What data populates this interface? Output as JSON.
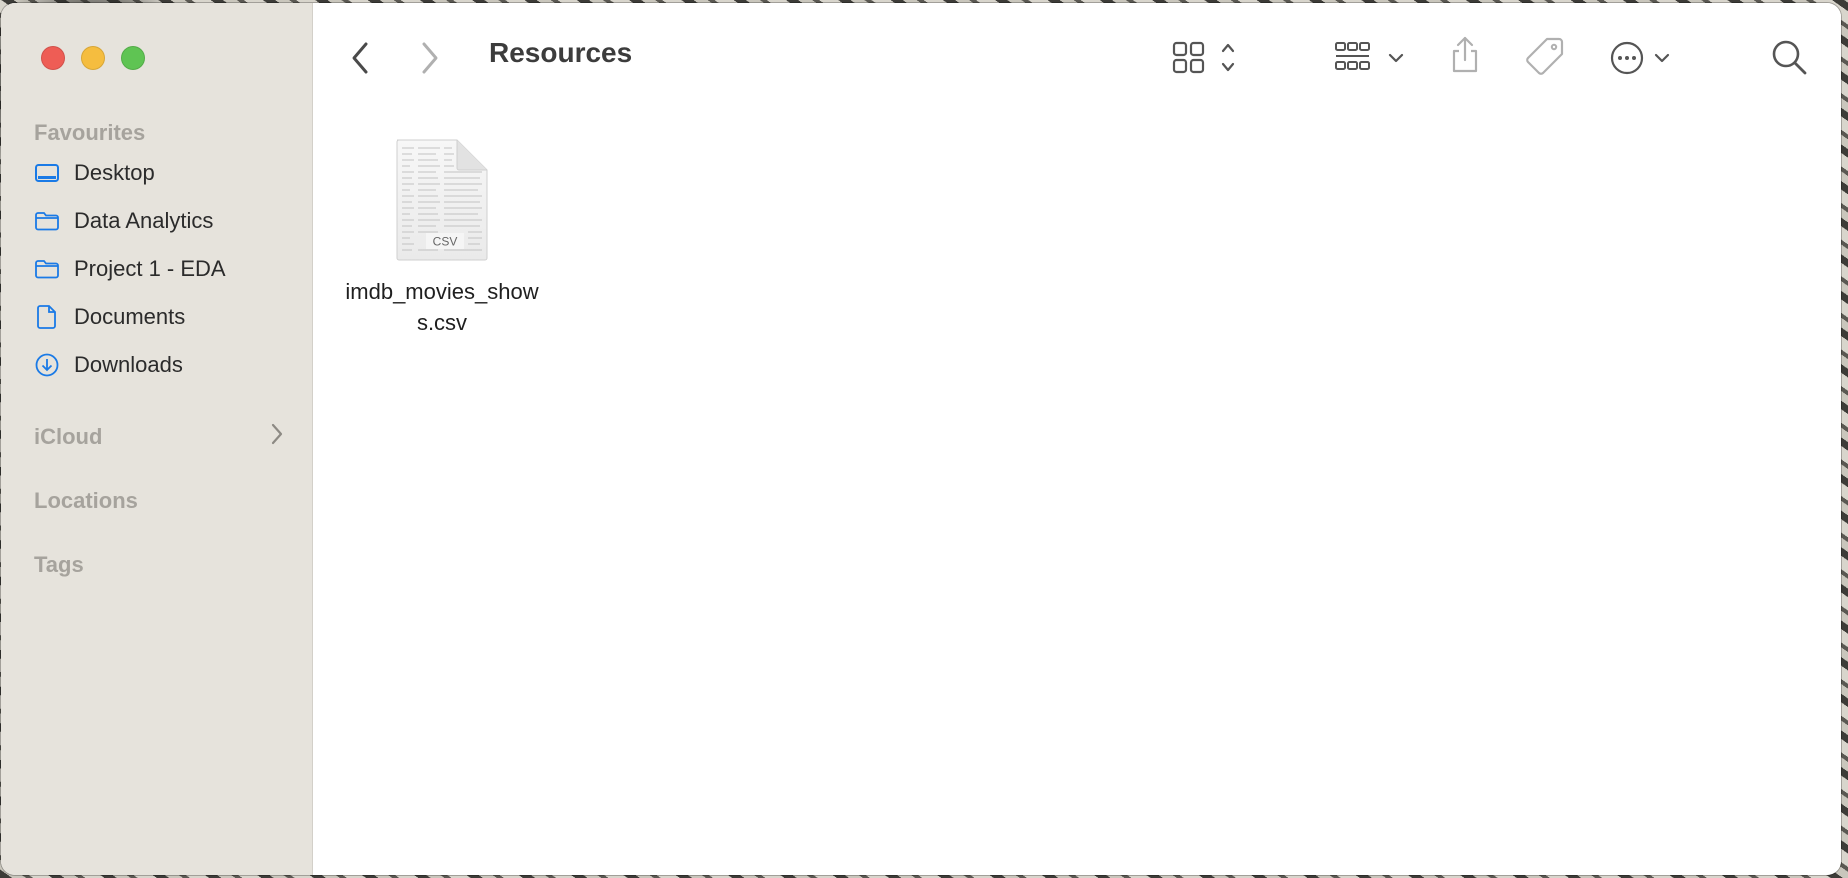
{
  "window": {
    "title": "Resources",
    "traffic_lights": {
      "close": "#ee5d55",
      "minimize": "#f5bd3f",
      "maximize": "#5fc453"
    }
  },
  "sidebar": {
    "favourites_title": "Favourites",
    "items": [
      {
        "label": "Desktop",
        "icon": "desktop-icon"
      },
      {
        "label": "Data Analytics",
        "icon": "folder-icon"
      },
      {
        "label": "Project 1 - EDA",
        "icon": "folder-icon"
      },
      {
        "label": "Documents",
        "icon": "document-icon"
      },
      {
        "label": "Downloads",
        "icon": "download-icon"
      }
    ],
    "icloud_title": "iCloud",
    "locations_title": "Locations",
    "tags_title": "Tags",
    "accent_color": "#1a7ae6"
  },
  "toolbar": {
    "buttons": [
      "back-icon",
      "forward-icon",
      "icon-view-icon",
      "group-icon",
      "share-icon",
      "tag-icon",
      "more-icon",
      "search-icon"
    ]
  },
  "files": [
    {
      "name": "imdb_movies_shows.csv",
      "type_badge": "CSV"
    }
  ]
}
